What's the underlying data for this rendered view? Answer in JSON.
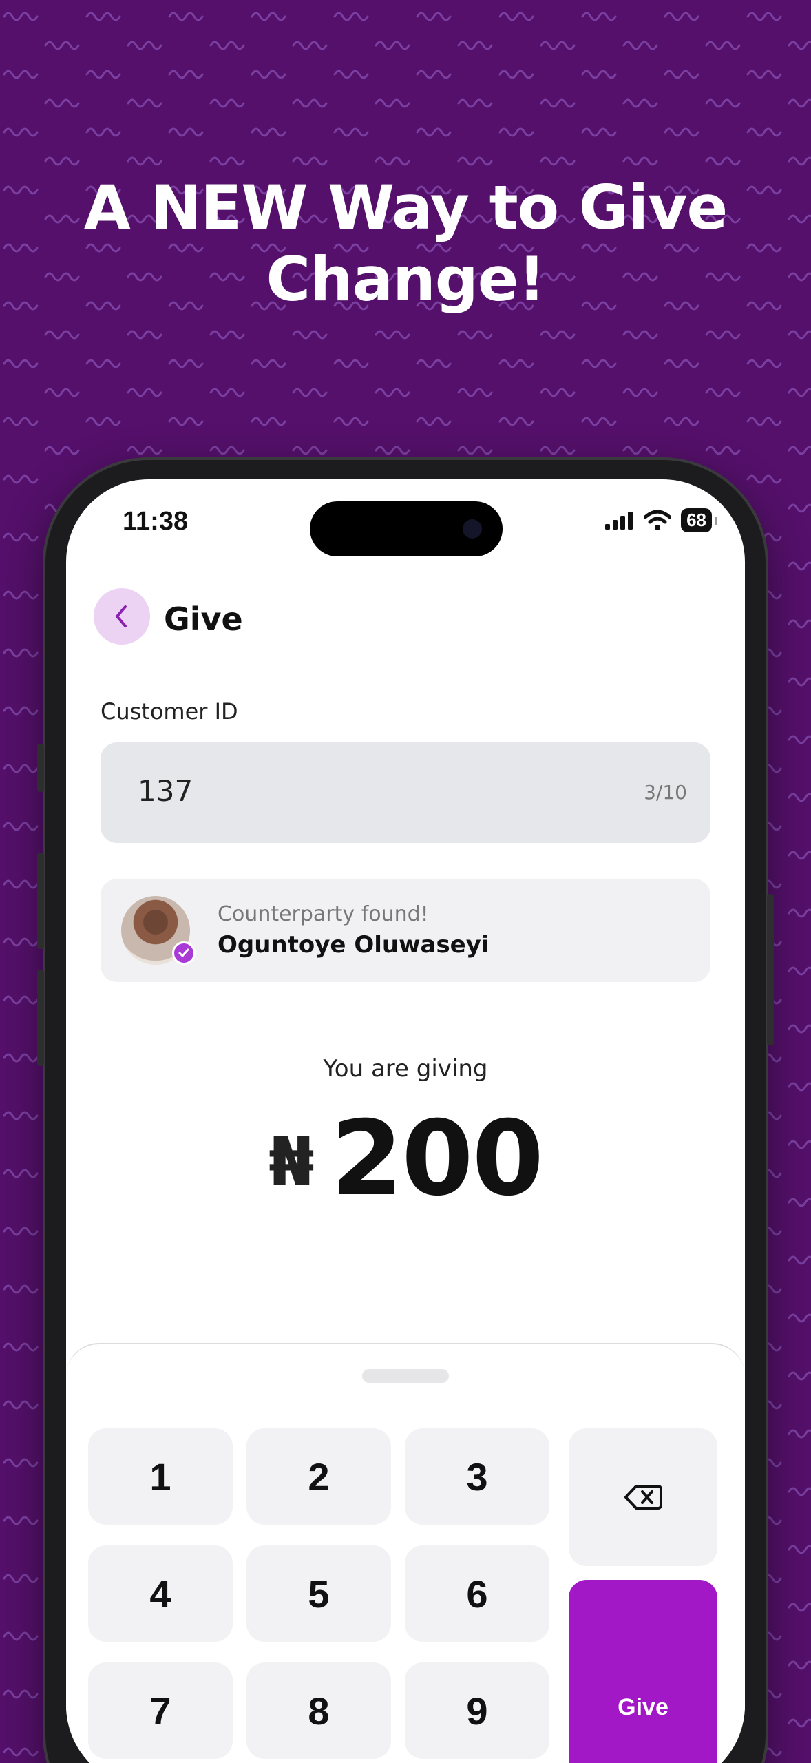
{
  "promo": {
    "headline_line1": "A NEW Way to Give",
    "headline_line2": "Change!"
  },
  "status_bar": {
    "time": "11:38",
    "battery": "68",
    "icons": [
      "cellular-signal-icon",
      "wifi-icon",
      "battery-icon"
    ]
  },
  "header": {
    "back_icon": "chevron-left-icon",
    "title": "Give"
  },
  "customer_id": {
    "label": "Customer ID",
    "value": "137",
    "counter": "3/10"
  },
  "counterparty": {
    "status": "Counterparty found!",
    "name": "Oguntoye Oluwaseyi",
    "verified_icon": "check-badge-icon"
  },
  "giving": {
    "label": "You are giving",
    "currency": "₦",
    "amount": "200"
  },
  "keypad": {
    "keys": [
      "1",
      "2",
      "3",
      "4",
      "5",
      "6",
      "7",
      "8",
      "9"
    ],
    "backspace_icon": "backspace-icon",
    "give_label": "Give"
  },
  "colors": {
    "background": "#54106a",
    "accent": "#a318c6",
    "back_button_bg": "#ecd3f3"
  }
}
